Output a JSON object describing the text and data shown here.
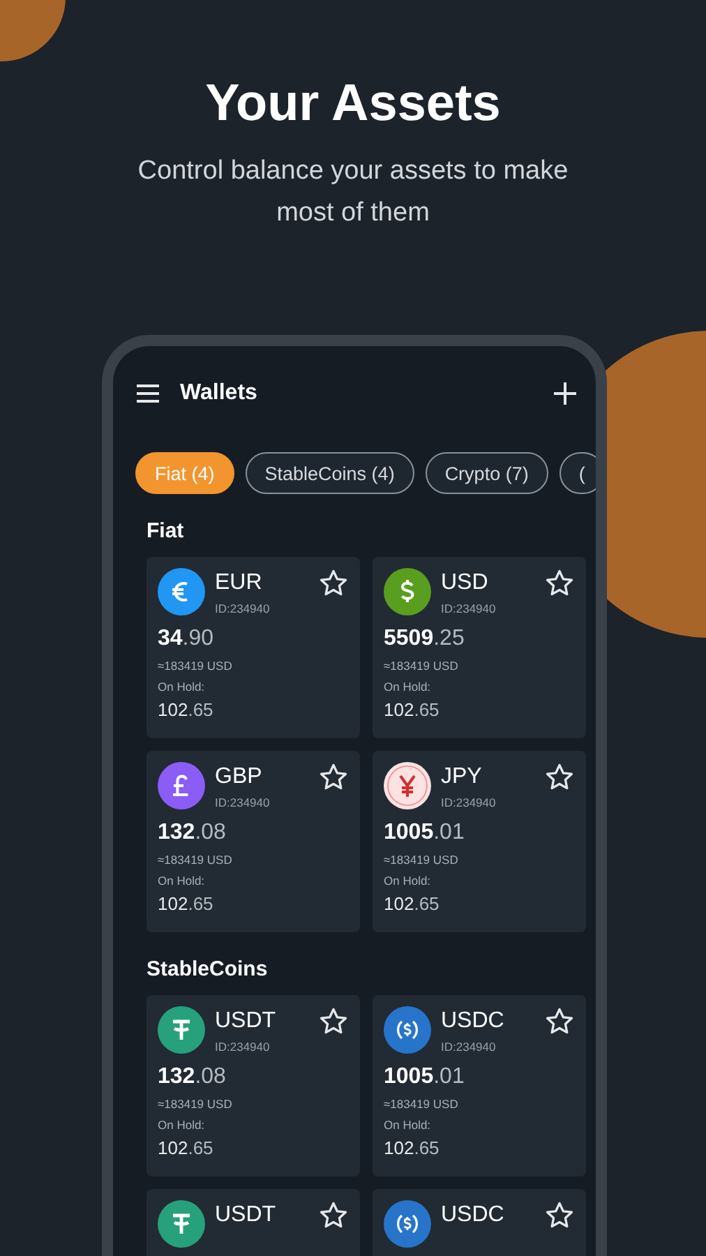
{
  "header": {
    "title": "Your Assets",
    "subtitle": "Control balance your assets to make most of them"
  },
  "app_bar": {
    "title": "Wallets"
  },
  "tabs": [
    {
      "label": "Fiat (4)",
      "selected": true
    },
    {
      "label": "StableCoins (4)",
      "selected": false
    },
    {
      "label": "Crypto (7)",
      "selected": false
    },
    {
      "label": "(",
      "selected": false
    }
  ],
  "sections": [
    {
      "title": "Fiat",
      "wallets": [
        {
          "kind": "euro",
          "color": "#2196f3",
          "name": "EUR",
          "id": "ID:234940",
          "balance": "34.90",
          "usd": "≈183419 USD",
          "hold_label": "On Hold:",
          "hold": "102.65"
        },
        {
          "kind": "dollar",
          "color": "#5a9e1f",
          "name": "USD",
          "id": "ID:234940",
          "balance": "5509.25",
          "usd": "≈183419 USD",
          "hold_label": "On Hold:",
          "hold": "102.65"
        },
        {
          "kind": "pound",
          "color": "#8b5cf6",
          "name": "GBP",
          "id": "ID:234940",
          "balance": "132.08",
          "usd": "≈183419 USD",
          "hold_label": "On Hold:",
          "hold": "102.65"
        },
        {
          "kind": "yen",
          "color": "#fde2e2",
          "name": "JPY",
          "id": "ID:234940",
          "balance": "1005.01",
          "usd": "≈183419 USD",
          "hold_label": "On Hold:",
          "hold": "102.65"
        }
      ]
    },
    {
      "title": "StableCoins",
      "wallets": [
        {
          "kind": "tether",
          "color": "#26a17b",
          "name": "USDT",
          "id": "ID:234940",
          "balance": "132.08",
          "usd": "≈183419 USD",
          "hold_label": "On Hold:",
          "hold": "102.65"
        },
        {
          "kind": "usdc",
          "color": "#2775ca",
          "name": "USDC",
          "id": "ID:234940",
          "balance": "1005.01",
          "usd": "≈183419 USD",
          "hold_label": "On Hold:",
          "hold": "102.65"
        },
        {
          "kind": "tether",
          "color": "#26a17b",
          "name": "USDT"
        },
        {
          "kind": "usdc",
          "color": "#2775ca",
          "name": "USDC"
        }
      ]
    }
  ]
}
